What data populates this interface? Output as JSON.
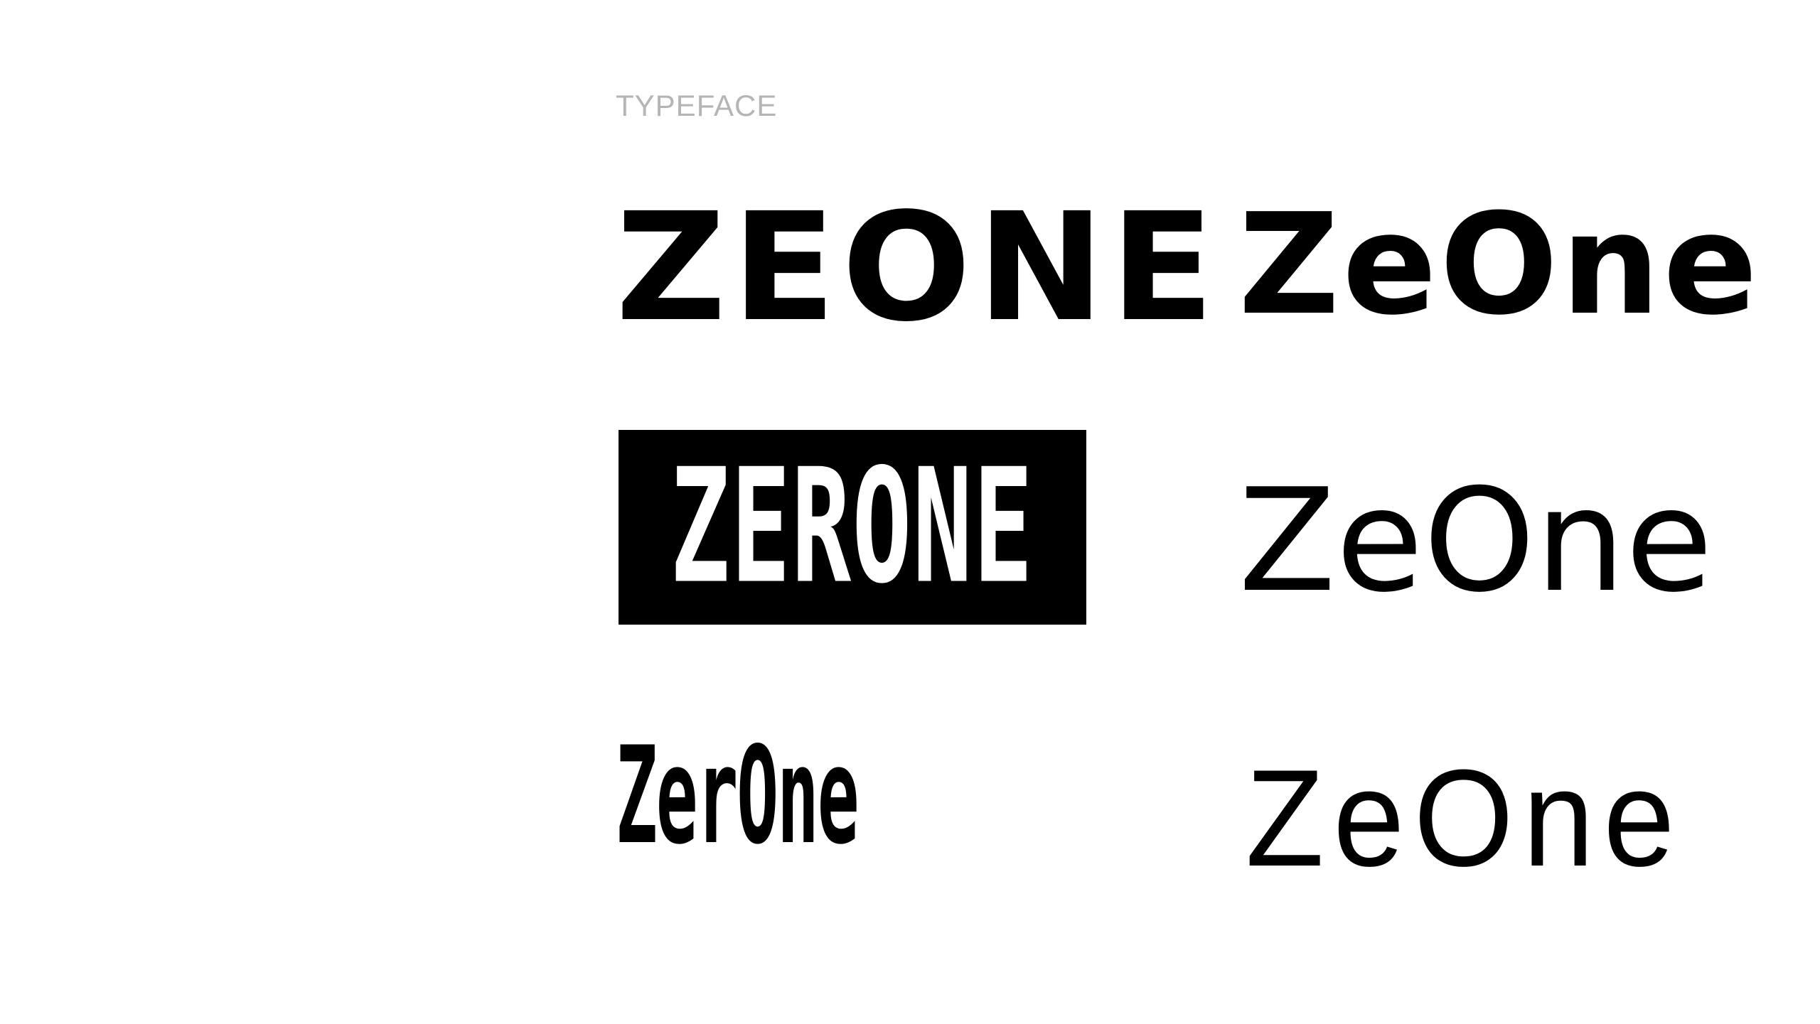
{
  "section_label": "TYPEFACE",
  "samples": {
    "left_1": "ZEONE",
    "left_2": "ZERONE",
    "left_3": "ZerOne",
    "right_1": "ZeOne",
    "right_2": "ZeOne",
    "right_3": "ZeOne"
  },
  "colors": {
    "background": "#ffffff",
    "ink": "#000000",
    "label": "#b5b5b5"
  }
}
